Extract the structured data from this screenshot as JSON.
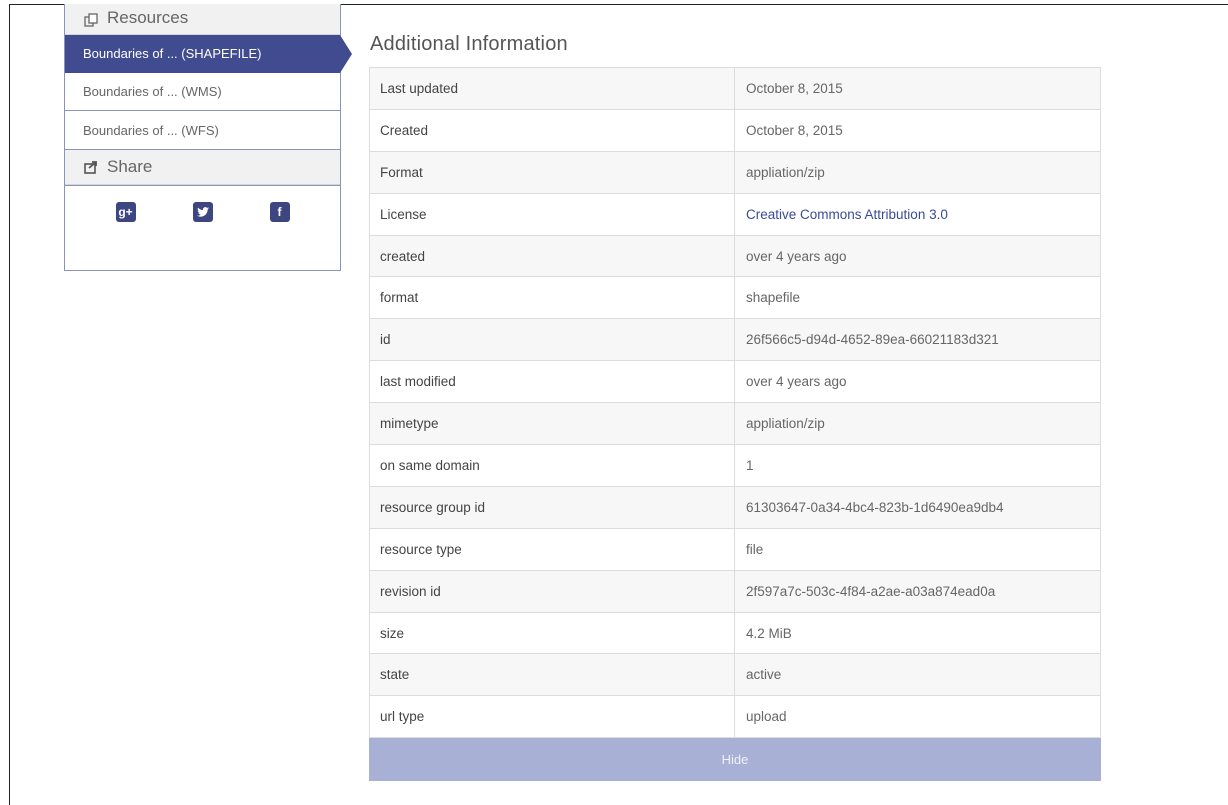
{
  "sidebar": {
    "resources_heading": "Resources",
    "items": [
      {
        "label": "Boundaries of ... (SHAPEFILE)",
        "active": true
      },
      {
        "label": "Boundaries of ... (WMS)",
        "active": false
      },
      {
        "label": "Boundaries of ... (WFS)",
        "active": false
      }
    ],
    "share_heading": "Share",
    "social": [
      {
        "icon": "google-plus-icon",
        "glyph": "g+"
      },
      {
        "icon": "twitter-icon",
        "glyph": "t"
      },
      {
        "icon": "facebook-icon",
        "glyph": "f"
      }
    ]
  },
  "main": {
    "title": "Additional Information",
    "rows": [
      {
        "key": "Last updated",
        "value": "October 8, 2015"
      },
      {
        "key": "Created",
        "value": "October 8, 2015"
      },
      {
        "key": "Format",
        "value": "appliation/zip"
      },
      {
        "key": "License",
        "value": "Creative Commons Attribution 3.0",
        "link": true
      },
      {
        "key": "created",
        "value": "over 4 years ago"
      },
      {
        "key": "format",
        "value": "shapefile"
      },
      {
        "key": "id",
        "value": "26f566c5-d94d-4652-89ea-66021183d321"
      },
      {
        "key": "last modified",
        "value": "over 4 years ago"
      },
      {
        "key": "mimetype",
        "value": "appliation/zip"
      },
      {
        "key": "on same domain",
        "value": "1"
      },
      {
        "key": "resource group id",
        "value": "61303647-0a34-4bc4-823b-1d6490ea9db4"
      },
      {
        "key": "resource type",
        "value": "file"
      },
      {
        "key": "revision id",
        "value": "2f597a7c-503c-4f84-a2ae-a03a874ead0a"
      },
      {
        "key": "size",
        "value": "4.2 MiB"
      },
      {
        "key": "state",
        "value": "active"
      },
      {
        "key": "url type",
        "value": "upload"
      }
    ],
    "hide_label": "Hide"
  },
  "colors": {
    "accent": "#414b8f",
    "hide_button": "#a9b0d6",
    "link": "#3c4a94"
  }
}
